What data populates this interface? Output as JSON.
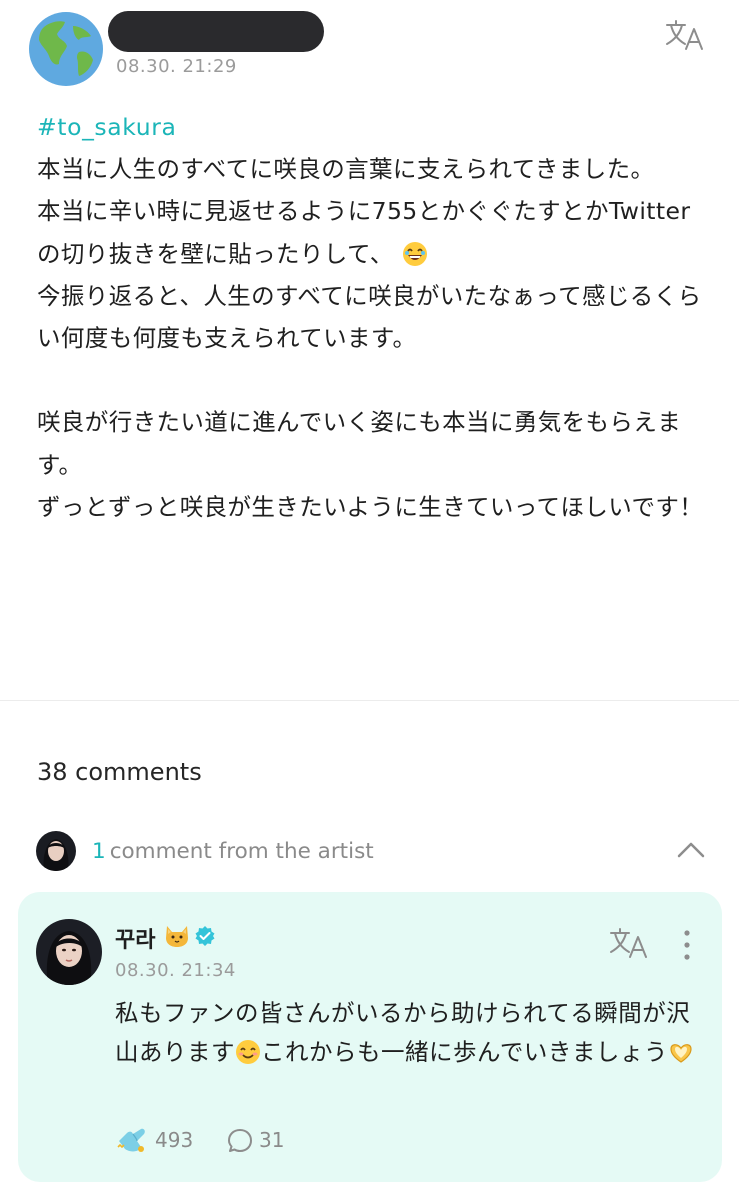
{
  "post": {
    "time": "08.30. 21:29",
    "hashtag": "#to_sakura",
    "text": "本当に人生のすべてに咲良の言葉に支えられてきました。\n本当に辛い時に見返せるように755とかぐぐたすとかTwitterの切り抜きを壁に貼ったりして、",
    "text2": "今振り返ると、人生のすべてに咲良がいたなぁって感じるくらい何度も何度も支えられています。\n\n咲良が行きたい道に進んでいく姿にも本当に勇気をもらえます。\nずっとずっと咲良が生きたいように生きていってほしいです！"
  },
  "comments": {
    "count_label": "38 comments",
    "artist_row": {
      "count": "1",
      "label": "comment from the artist"
    }
  },
  "artist_comment": {
    "name": "꾸라",
    "time": "08.30. 21:34",
    "text_part1": "私もファンの皆さんがいるから助けられてる瞬間が沢山あります",
    "text_part2": "これからも一緒に歩んでいきましょう",
    "likes": "493",
    "replies": "31"
  },
  "colors": {
    "accent": "#1bb5b8",
    "card_bg": "#e5faf5",
    "muted": "#9b9b9b"
  },
  "icons": [
    "globe-icon",
    "translate-icon",
    "chevron-up-icon",
    "verified-icon",
    "more-icon",
    "like-icon",
    "comment-icon",
    "cat-emoji",
    "grin-emoji",
    "smile-emoji",
    "heart-hands-emoji"
  ]
}
